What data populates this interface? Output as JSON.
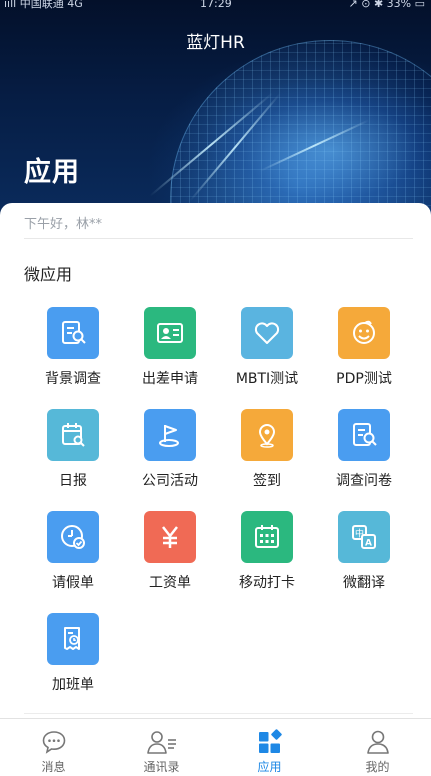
{
  "status_bar": {
    "carrier": "ııll 中国联通 4G",
    "time": "17:29",
    "right": "↗ ⊙ ✱ 33% ▭"
  },
  "nav": {
    "title": "蓝灯HR"
  },
  "hero": {
    "title": "应用"
  },
  "greeting": "下午好，林**",
  "section": {
    "title": "微应用"
  },
  "apps": [
    {
      "label": "背景调查",
      "icon": "document-search-icon",
      "color": "#4a9df0"
    },
    {
      "label": "出差申请",
      "icon": "id-card-icon",
      "color": "#2bb87f"
    },
    {
      "label": "MBTI测试",
      "icon": "heart-icon",
      "color": "#5ab4e0"
    },
    {
      "label": "PDP测试",
      "icon": "smiley-icon",
      "color": "#f5a93a"
    },
    {
      "label": "日报",
      "icon": "calendar-search-icon",
      "color": "#56b8d8"
    },
    {
      "label": "公司活动",
      "icon": "flag-icon",
      "color": "#4a9df0"
    },
    {
      "label": "签到",
      "icon": "location-pin-icon",
      "color": "#f5a93a"
    },
    {
      "label": "调查问卷",
      "icon": "document-search-icon",
      "color": "#4a9df0"
    },
    {
      "label": "请假单",
      "icon": "clock-check-icon",
      "color": "#4a9df0"
    },
    {
      "label": "工资单",
      "icon": "yen-icon",
      "color": "#f06a55"
    },
    {
      "label": "移动打卡",
      "icon": "calendar-grid-icon",
      "color": "#2bb87f"
    },
    {
      "label": "微翻译",
      "icon": "translate-icon",
      "color": "#56b8d8"
    },
    {
      "label": "加班单",
      "icon": "receipt-clock-icon",
      "color": "#4a9df0"
    }
  ],
  "tabs": [
    {
      "label": "消息",
      "icon": "chat-bubble-icon"
    },
    {
      "label": "通讯录",
      "icon": "contacts-icon"
    },
    {
      "label": "应用",
      "icon": "apps-grid-icon",
      "active": true
    },
    {
      "label": "我的",
      "icon": "person-icon"
    }
  ],
  "colors": {
    "accent": "#1e88e5",
    "tab_inactive": "#666666"
  }
}
